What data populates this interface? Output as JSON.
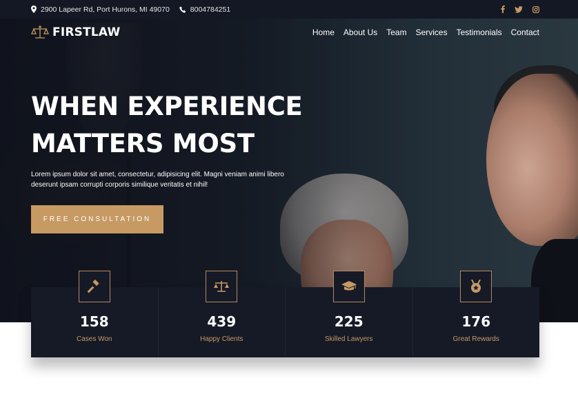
{
  "topbar": {
    "address": "2900 Lapeer Rd, Port Hurons, MI 49070",
    "phone": "8004784251",
    "social": [
      "facebook-icon",
      "twitter-icon",
      "instagram-icon"
    ]
  },
  "brand": {
    "name": "FIRSTLAW"
  },
  "nav": {
    "items": [
      "Home",
      "About Us",
      "Team",
      "Services",
      "Testimonials",
      "Contact"
    ]
  },
  "hero": {
    "headline_line1": "WHEN EXPERIENCE",
    "headline_line2": "MATTERS MOST",
    "lead": "Lorem ipsum dolor sit amet, consectetur, adipisicing elit. Magni veniam animi libero deserunt ipsam corrupti corporis similique veritatis et nihil!",
    "cta": "FREE CONSULTATION"
  },
  "stats": [
    {
      "icon": "gavel-icon",
      "value": "158",
      "label": "Cases Won"
    },
    {
      "icon": "scales-icon",
      "value": "439",
      "label": "Happy Clients"
    },
    {
      "icon": "graduation-cap-icon",
      "value": "225",
      "label": "Skilled Lawyers"
    },
    {
      "icon": "medal-icon",
      "value": "176",
      "label": "Great Rewards"
    }
  ],
  "colors": {
    "accent": "#c79a64",
    "dark": "#161a27",
    "topbar": "#141824"
  }
}
